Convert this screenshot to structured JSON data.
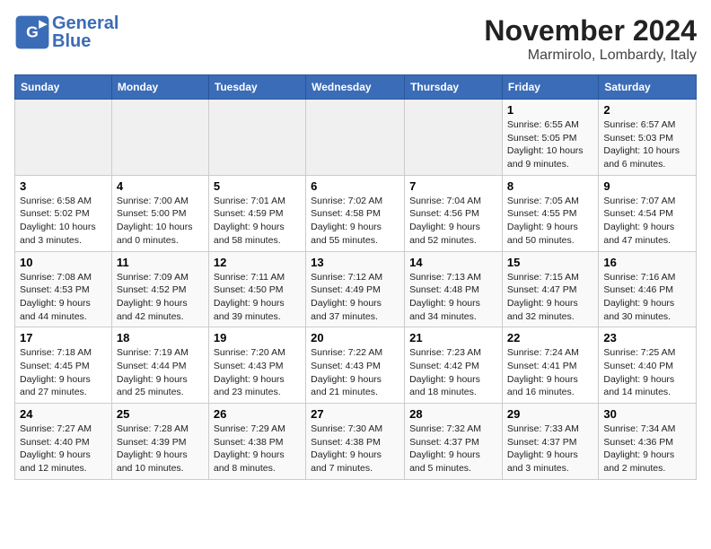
{
  "header": {
    "logo_general": "General",
    "logo_blue": "Blue",
    "month": "November 2024",
    "location": "Marmirolo, Lombardy, Italy"
  },
  "weekdays": [
    "Sunday",
    "Monday",
    "Tuesday",
    "Wednesday",
    "Thursday",
    "Friday",
    "Saturday"
  ],
  "weeks": [
    [
      {
        "day": "",
        "info": ""
      },
      {
        "day": "",
        "info": ""
      },
      {
        "day": "",
        "info": ""
      },
      {
        "day": "",
        "info": ""
      },
      {
        "day": "",
        "info": ""
      },
      {
        "day": "1",
        "info": "Sunrise: 6:55 AM\nSunset: 5:05 PM\nDaylight: 10 hours\nand 9 minutes."
      },
      {
        "day": "2",
        "info": "Sunrise: 6:57 AM\nSunset: 5:03 PM\nDaylight: 10 hours\nand 6 minutes."
      }
    ],
    [
      {
        "day": "3",
        "info": "Sunrise: 6:58 AM\nSunset: 5:02 PM\nDaylight: 10 hours\nand 3 minutes."
      },
      {
        "day": "4",
        "info": "Sunrise: 7:00 AM\nSunset: 5:00 PM\nDaylight: 10 hours\nand 0 minutes."
      },
      {
        "day": "5",
        "info": "Sunrise: 7:01 AM\nSunset: 4:59 PM\nDaylight: 9 hours\nand 58 minutes."
      },
      {
        "day": "6",
        "info": "Sunrise: 7:02 AM\nSunset: 4:58 PM\nDaylight: 9 hours\nand 55 minutes."
      },
      {
        "day": "7",
        "info": "Sunrise: 7:04 AM\nSunset: 4:56 PM\nDaylight: 9 hours\nand 52 minutes."
      },
      {
        "day": "8",
        "info": "Sunrise: 7:05 AM\nSunset: 4:55 PM\nDaylight: 9 hours\nand 50 minutes."
      },
      {
        "day": "9",
        "info": "Sunrise: 7:07 AM\nSunset: 4:54 PM\nDaylight: 9 hours\nand 47 minutes."
      }
    ],
    [
      {
        "day": "10",
        "info": "Sunrise: 7:08 AM\nSunset: 4:53 PM\nDaylight: 9 hours\nand 44 minutes."
      },
      {
        "day": "11",
        "info": "Sunrise: 7:09 AM\nSunset: 4:52 PM\nDaylight: 9 hours\nand 42 minutes."
      },
      {
        "day": "12",
        "info": "Sunrise: 7:11 AM\nSunset: 4:50 PM\nDaylight: 9 hours\nand 39 minutes."
      },
      {
        "day": "13",
        "info": "Sunrise: 7:12 AM\nSunset: 4:49 PM\nDaylight: 9 hours\nand 37 minutes."
      },
      {
        "day": "14",
        "info": "Sunrise: 7:13 AM\nSunset: 4:48 PM\nDaylight: 9 hours\nand 34 minutes."
      },
      {
        "day": "15",
        "info": "Sunrise: 7:15 AM\nSunset: 4:47 PM\nDaylight: 9 hours\nand 32 minutes."
      },
      {
        "day": "16",
        "info": "Sunrise: 7:16 AM\nSunset: 4:46 PM\nDaylight: 9 hours\nand 30 minutes."
      }
    ],
    [
      {
        "day": "17",
        "info": "Sunrise: 7:18 AM\nSunset: 4:45 PM\nDaylight: 9 hours\nand 27 minutes."
      },
      {
        "day": "18",
        "info": "Sunrise: 7:19 AM\nSunset: 4:44 PM\nDaylight: 9 hours\nand 25 minutes."
      },
      {
        "day": "19",
        "info": "Sunrise: 7:20 AM\nSunset: 4:43 PM\nDaylight: 9 hours\nand 23 minutes."
      },
      {
        "day": "20",
        "info": "Sunrise: 7:22 AM\nSunset: 4:43 PM\nDaylight: 9 hours\nand 21 minutes."
      },
      {
        "day": "21",
        "info": "Sunrise: 7:23 AM\nSunset: 4:42 PM\nDaylight: 9 hours\nand 18 minutes."
      },
      {
        "day": "22",
        "info": "Sunrise: 7:24 AM\nSunset: 4:41 PM\nDaylight: 9 hours\nand 16 minutes."
      },
      {
        "day": "23",
        "info": "Sunrise: 7:25 AM\nSunset: 4:40 PM\nDaylight: 9 hours\nand 14 minutes."
      }
    ],
    [
      {
        "day": "24",
        "info": "Sunrise: 7:27 AM\nSunset: 4:40 PM\nDaylight: 9 hours\nand 12 minutes."
      },
      {
        "day": "25",
        "info": "Sunrise: 7:28 AM\nSunset: 4:39 PM\nDaylight: 9 hours\nand 10 minutes."
      },
      {
        "day": "26",
        "info": "Sunrise: 7:29 AM\nSunset: 4:38 PM\nDaylight: 9 hours\nand 8 minutes."
      },
      {
        "day": "27",
        "info": "Sunrise: 7:30 AM\nSunset: 4:38 PM\nDaylight: 9 hours\nand 7 minutes."
      },
      {
        "day": "28",
        "info": "Sunrise: 7:32 AM\nSunset: 4:37 PM\nDaylight: 9 hours\nand 5 minutes."
      },
      {
        "day": "29",
        "info": "Sunrise: 7:33 AM\nSunset: 4:37 PM\nDaylight: 9 hours\nand 3 minutes."
      },
      {
        "day": "30",
        "info": "Sunrise: 7:34 AM\nSunset: 4:36 PM\nDaylight: 9 hours\nand 2 minutes."
      }
    ]
  ]
}
